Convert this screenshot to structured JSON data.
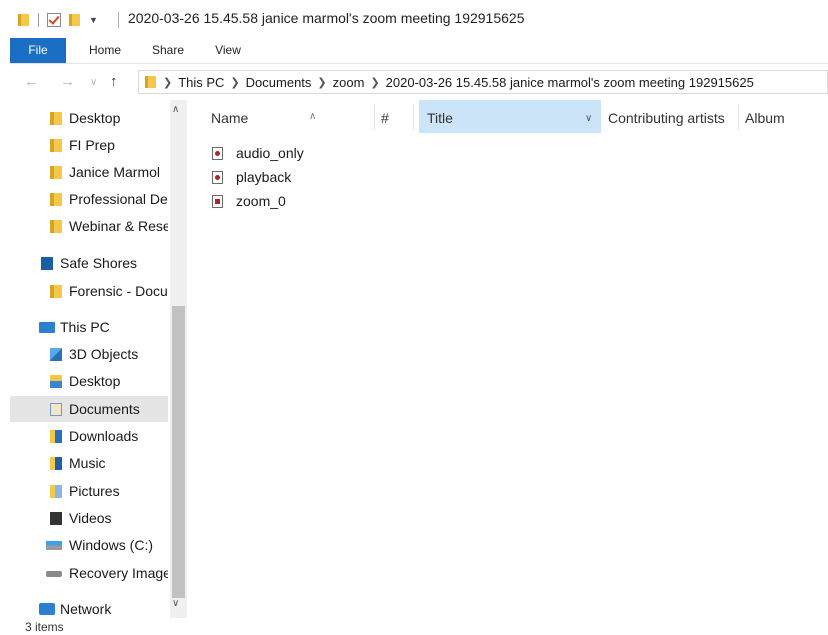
{
  "window": {
    "title": "2020-03-26 15.45.58 janice marmol's zoom meeting 192915625"
  },
  "ribbon": {
    "tabs": [
      "File",
      "Home",
      "Share",
      "View"
    ]
  },
  "nav": {
    "back_icon": "back-arrow-icon",
    "forward_icon": "forward-arrow-icon",
    "up_icon": "up-arrow-icon",
    "breadcrumb": [
      "This PC",
      "Documents",
      "zoom",
      "2020-03-26 15.45.58 janice marmol's zoom meeting 192915625"
    ]
  },
  "sidebar": {
    "quick_access": [
      "Desktop",
      "FI Prep",
      "Janice Marmol",
      "Professional Dev",
      "Webinar & Resea"
    ],
    "safe_shores": "Safe Shores",
    "forensic": "Forensic - Docur",
    "this_pc": "This PC",
    "pc_items": [
      "3D Objects",
      "Desktop",
      "Documents",
      "Downloads",
      "Music",
      "Pictures",
      "Videos",
      "Windows (C:)",
      "Recovery Image"
    ],
    "network": "Network",
    "selected": "Documents"
  },
  "columns": {
    "name": "Name",
    "number": "#",
    "title": "Title",
    "contributing_artists": "Contributing artists",
    "album": "Album"
  },
  "files": [
    {
      "name": "audio_only",
      "icon": "audio-file-icon"
    },
    {
      "name": "playback",
      "icon": "audio-file-icon"
    },
    {
      "name": "zoom_0",
      "icon": "video-file-icon"
    }
  ],
  "status": {
    "item_count": "3 items"
  },
  "colors": {
    "file_tab": "#1a6fc4",
    "title_col_highlight": "#cce4f7",
    "selected_nav": "#e5e5e5"
  }
}
